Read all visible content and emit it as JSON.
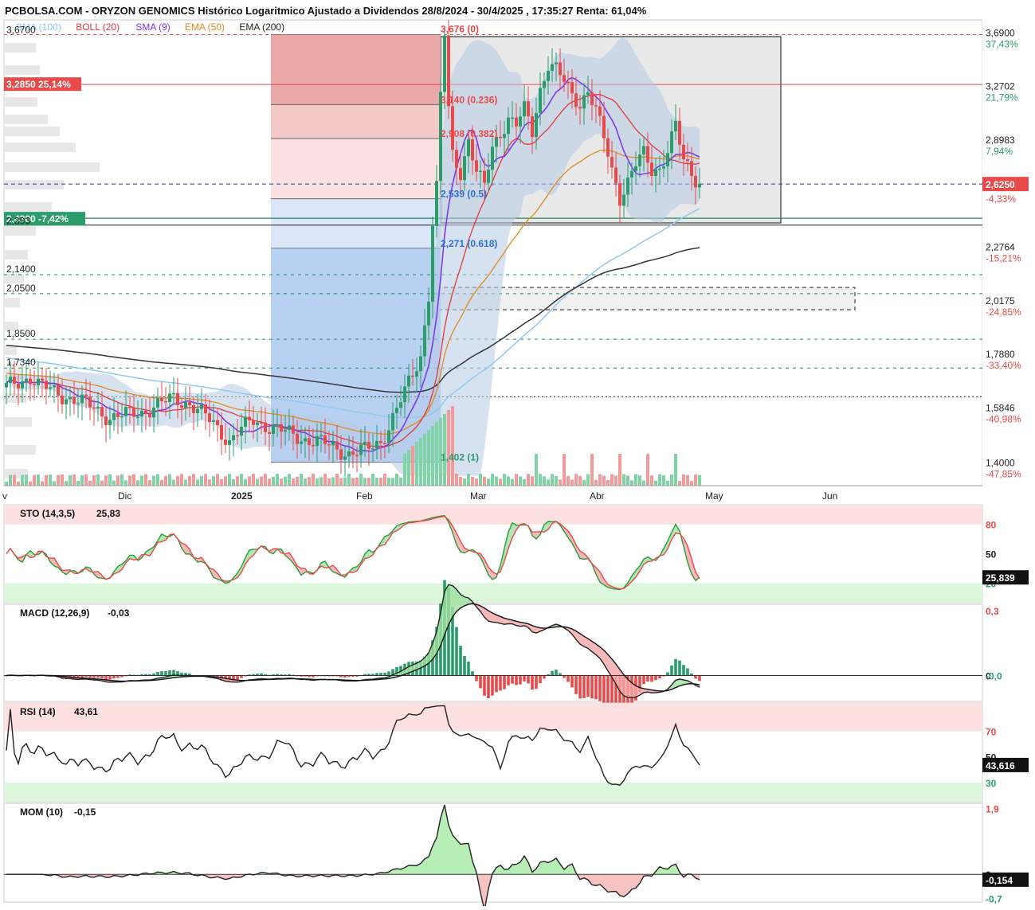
{
  "header": {
    "title": "PCBOLSA.COM - ORYZON GENOMICS Histórico Logaritmico Ajustado a Dividendos 28/8/2024 - 30/4/2025 , 17:35:27 Renta: 61,04%"
  },
  "legend": [
    {
      "text": "SMA (100)",
      "color": "#8ec9ef"
    },
    {
      "text": "BOLL (20)",
      "color": "#e03a3a"
    },
    {
      "text": "SMA (9)",
      "color": "#7b2ff0"
    },
    {
      "text": "EMA (50)",
      "color": "#e08a20"
    },
    {
      "text": "EMA (200)",
      "color": "#222222"
    }
  ],
  "colors": {
    "up": "#2a9d6a",
    "down": "#e84a4a",
    "sma100": "#8ec9ef",
    "boll": "#e03a3a",
    "sma9": "#7b2ff0",
    "ema50": "#e08a20",
    "ema200": "#333333",
    "grid_dash": "#1f8a5e"
  },
  "price_axis": {
    "ticks": [
      {
        "label": "3,6900",
        "pct": "37,43%",
        "pct_color": "#2a9d6a",
        "value": 3.69
      },
      {
        "label": "3,2702",
        "pct": "21,79%",
        "pct_color": "#2a9d6a",
        "value": 3.2702
      },
      {
        "label": "2,8983",
        "pct": "7,94%",
        "pct_color": "#2a9d6a",
        "value": 2.8983
      },
      {
        "label": "2,6250",
        "pct": "-4,33%",
        "pct_color": "#e84a4a",
        "value": 2.625,
        "highlight": true,
        "bg": "#e84a4a"
      },
      {
        "label": "2,2764",
        "pct": "-15,21%",
        "pct_color": "#e84a4a",
        "value": 2.2764
      },
      {
        "label": "2,0175",
        "pct": "-24,85%",
        "pct_color": "#e84a4a",
        "value": 2.0175
      },
      {
        "label": "1,7880",
        "pct": "-33,40%",
        "pct_color": "#e84a4a",
        "value": 1.788
      },
      {
        "label": "1,5846",
        "pct": "-40,98%",
        "pct_color": "#e84a4a",
        "value": 1.5846
      },
      {
        "label": "1,4000",
        "pct": "-47,85%",
        "pct_color": "#e84a4a",
        "value": 1.4
      }
    ]
  },
  "left_levels": [
    {
      "label": "3,6700",
      "value": 3.67
    },
    {
      "label": "2,1400",
      "value": 2.14
    },
    {
      "label": "2,0500",
      "value": 2.05
    },
    {
      "label": "1,8500",
      "value": 1.85
    },
    {
      "label": "1,7340",
      "value": 1.734
    }
  ],
  "tags": {
    "resistance": {
      "text": "3,2850  25,14%",
      "value": 3.285,
      "color": "#e84a4a"
    },
    "support": {
      "text": "2,4300  -7,42%",
      "value": 2.43,
      "color": "#2a9d6a"
    },
    "support_sub": "2,393"
  },
  "fib_labels": [
    {
      "text": "3,676 (0)",
      "value": 3.676,
      "color": "#e84a4a"
    },
    {
      "text": "3,140 (0.236)",
      "value": 3.14,
      "color": "#e84a4a"
    },
    {
      "text": "2,908 (0.382)",
      "value": 2.908,
      "color": "#e84a4a"
    },
    {
      "text": "2,539 (0.5)",
      "value": 2.539,
      "color": "#2f6fcf"
    },
    {
      "text": "2,271 (0.618)",
      "value": 2.271,
      "color": "#2f6fcf"
    },
    {
      "text": "1,402 (1)",
      "value": 1.402,
      "color": "#2a9d6a"
    }
  ],
  "x_axis": {
    "labels": [
      "v",
      "Dic",
      "2025",
      "Feb",
      "Mar",
      "Abr",
      "May",
      "Jun"
    ]
  },
  "panels": {
    "sto": {
      "title": "STO (14,3,5)",
      "value_text": "25,83",
      "ticks": [
        "80",
        "50",
        "20"
      ],
      "last": "25,839"
    },
    "macd": {
      "title": "MACD (12,26,9)",
      "value_text": "-0,03",
      "ticks": [
        "0,3",
        "0",
        "-0,0"
      ]
    },
    "rsi": {
      "title": "RSI (14)",
      "value_text": "43,61",
      "ticks": [
        "70",
        "50",
        "30"
      ],
      "last": "43,616"
    },
    "mom": {
      "title": "MOM (10)",
      "value_text": "-0,15",
      "ticks": [
        "1,9",
        "0",
        "-0,7"
      ],
      "last": "-0,154"
    }
  },
  "chart_data": {
    "type": "candlestick",
    "title": "PCBOLSA.COM - ORYZON GENOMICS Histórico Logaritmico Ajustado a Dividendos 28/8/2024 - 30/4/2025 , 17:35:27 Renta: 61,04%",
    "log_scale": true,
    "ylim": [
      1.33,
      3.8
    ],
    "last_close": 2.625,
    "approx_closes": {
      "Nov": 1.62,
      "Dic": 1.52,
      "2025-Jan": 1.45,
      "Feb-early": 1.42,
      "Feb-mid": 1.78,
      "Feb-late-peak": 3.676,
      "Mar-mid": 3.35,
      "Abr-early": 2.72,
      "Abr-late": 2.69,
      "last": 2.625
    },
    "fibonacci": [
      {
        "level": "0",
        "value": 3.676
      },
      {
        "level": "0.236",
        "value": 3.14
      },
      {
        "level": "0.382",
        "value": 2.908
      },
      {
        "level": "0.5",
        "value": 2.539
      },
      {
        "level": "0.618",
        "value": 2.271
      },
      {
        "level": "1",
        "value": 1.402
      }
    ],
    "indicators": {
      "STO": 25.839,
      "MACD": -0.03,
      "RSI": 43.616,
      "MOM": -0.154
    }
  }
}
